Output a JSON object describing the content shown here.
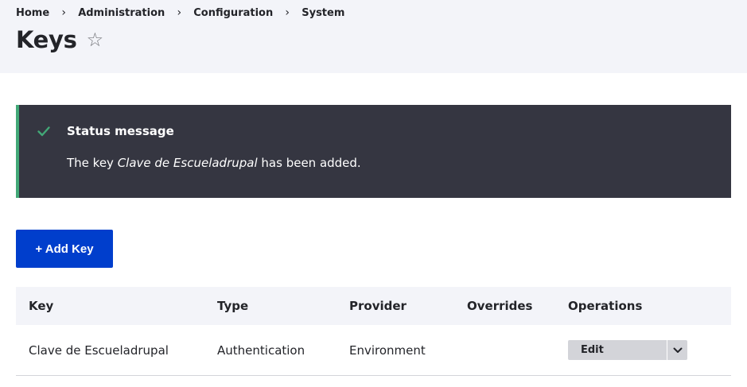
{
  "breadcrumb": {
    "items": [
      "Home",
      "Administration",
      "Configuration",
      "System"
    ],
    "separator": "›"
  },
  "page": {
    "title": "Keys",
    "favorite_icon": "star-outline-icon"
  },
  "status": {
    "icon": "check-icon",
    "title": "Status message",
    "text_before": "The key ",
    "key_name": "Clave de Escueladrupal",
    "text_after": " has been added."
  },
  "actions": {
    "add_key_label": "+ Add Key"
  },
  "table": {
    "headers": [
      "Key",
      "Type",
      "Provider",
      "Overrides",
      "Operations"
    ],
    "rows": [
      {
        "key": "Clave de Escueladrupal",
        "type": "Authentication",
        "provider": "Environment",
        "overrides": "",
        "operation_label": "Edit",
        "operation_toggle_icon": "chevron-down-icon"
      }
    ]
  },
  "colors": {
    "header_bg": "#f3f4f9",
    "status_bg": "#353641",
    "status_accent": "#42a877",
    "primary_button": "#003ecc"
  }
}
